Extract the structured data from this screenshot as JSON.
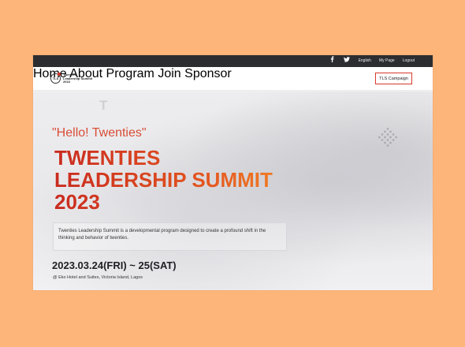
{
  "topbar": {
    "facebook_icon": "f",
    "twitter_icon": "t",
    "links": [
      "English",
      "My Page",
      "Logout"
    ]
  },
  "logo": {
    "mark": "TLS",
    "text": "Twenties Leadership Summit 2023"
  },
  "nav": {
    "items": [
      "Home",
      "About",
      "Program",
      "Join",
      "Sponsor"
    ],
    "campaign": "TLS Campaign"
  },
  "hero": {
    "deco_letter": "T",
    "hello": "\"Hello! Twenties\"",
    "title_line1": "TWENTIES",
    "title_line2": "LEADERSHIP SUMMIT",
    "title_line3": "2023",
    "description": "Twenties Leadership Summit is a developmental program designed to create a profound shift in the thinking and behavior of twenties.",
    "date": "2023.03.24(FRI) ~ 25(SAT)",
    "venue": "@ Eko Hotel and Suites, Victoria Island, Lagos"
  },
  "colors": {
    "accent": "#d9372b",
    "background": "#fdb57a",
    "topbar": "#2b2d31"
  }
}
